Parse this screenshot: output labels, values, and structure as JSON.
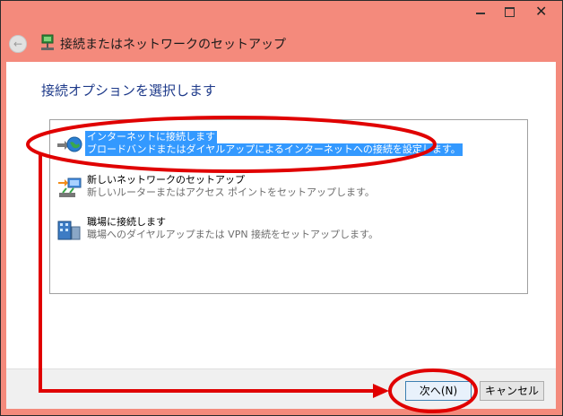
{
  "window": {
    "title": "接続またはネットワークのセットアップ",
    "controls": {
      "minimize": "—",
      "maximize": "□",
      "close": "✕"
    },
    "back_icon": "back-arrow-icon"
  },
  "page": {
    "heading": "接続オプションを選択します"
  },
  "options": [
    {
      "title": "インターネットに接続します",
      "description": "ブロードバンドまたはダイヤルアップによるインターネットへの接続を設定します。",
      "icon": "globe-icon",
      "selected": true
    },
    {
      "title": "新しいネットワークのセットアップ",
      "description": "新しいルーターまたはアクセス ポイントをセットアップします。",
      "icon": "router-setup-icon",
      "selected": false
    },
    {
      "title": "職場に接続します",
      "description": "職場へのダイヤルアップまたは VPN 接続をセットアップします。",
      "icon": "workplace-icon",
      "selected": false
    }
  ],
  "footer": {
    "next_label": "次へ(N)",
    "cancel_label": "キャンセル"
  },
  "colors": {
    "window_frame": "#f48a7c",
    "heading": "#1e3a8a",
    "selection": "#3399ff",
    "annotation": "#e00000"
  }
}
